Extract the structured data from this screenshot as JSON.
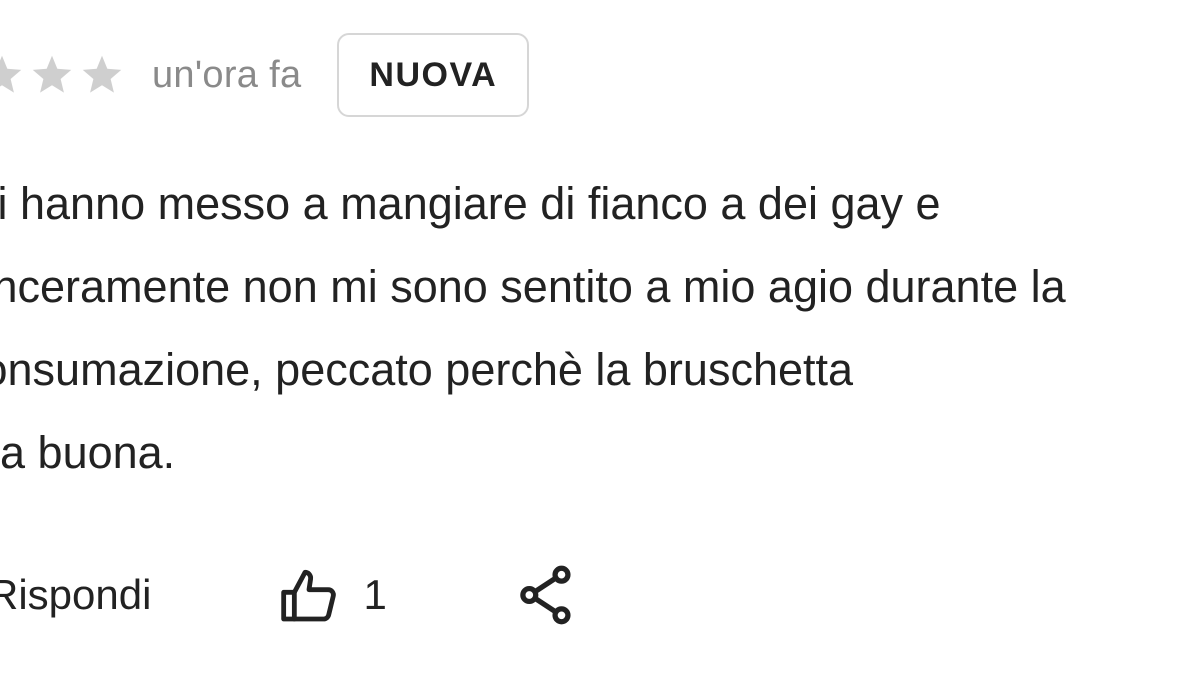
{
  "review": {
    "rating": {
      "value": 0,
      "max": 5,
      "visible_stars": 3,
      "star_color": "#cfcfcf"
    },
    "time_ago": "un'ora fa",
    "badge_label": "NUOVA",
    "text_lines": [
      "Mi hanno messo a mangiare di fianco a dei gay e",
      "sinceramente non mi sono sentito a mio agio durante la",
      "consumazione, peccato perchè la bruschetta",
      "era buona."
    ]
  },
  "actions": {
    "reply_label": "Rispondi",
    "like_icon": "thumbs-up-icon",
    "like_count": "1",
    "share_icon": "share-icon"
  }
}
